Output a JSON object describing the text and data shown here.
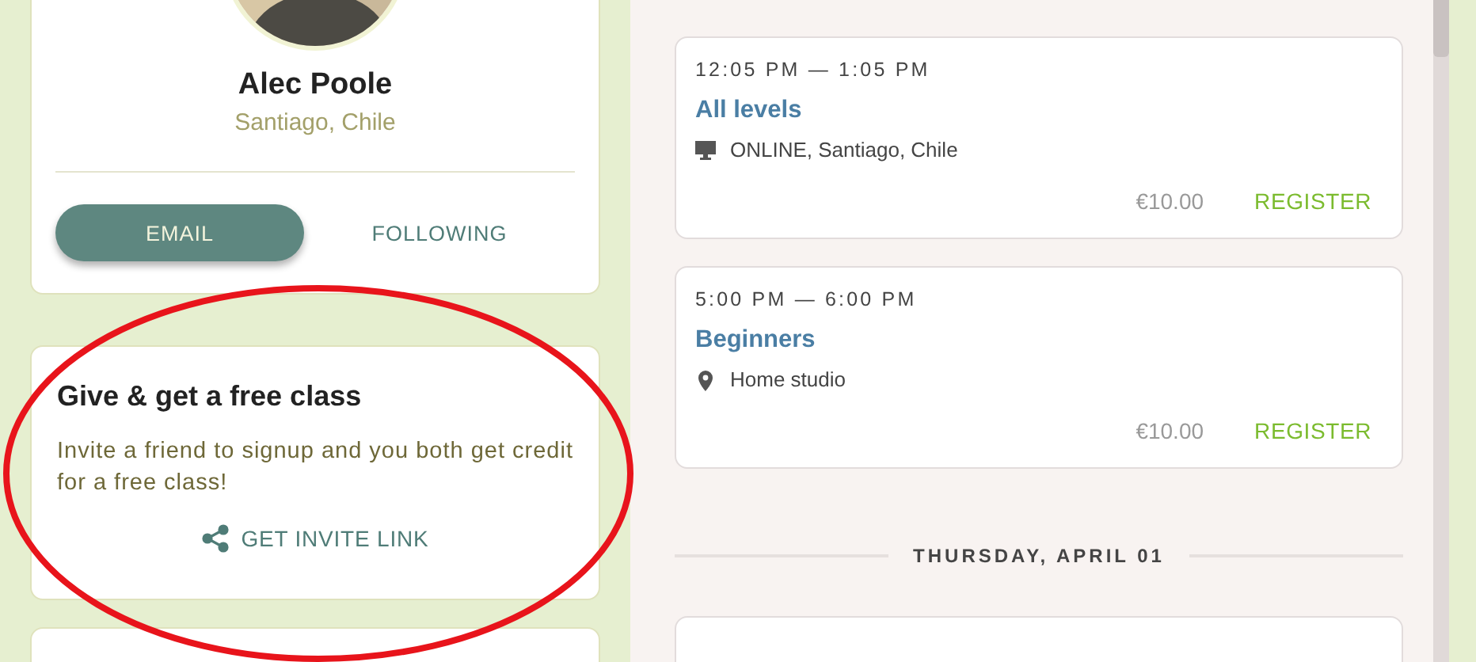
{
  "profile": {
    "name": "Alec Poole",
    "location": "Santiago, Chile",
    "buttons": [
      {
        "label": "EMAIL",
        "kind": "filled"
      },
      {
        "label": "FOLLOWING",
        "kind": "text"
      }
    ]
  },
  "invite": {
    "title": "Give & get a free class",
    "text": "Invite a friend to signup and you both get credit for a free class!",
    "link": "GET INVITE LINK"
  },
  "schedule": [
    {
      "kind": "class",
      "time": "12:05 PM — 1:05 PM",
      "title": "All levels",
      "location": {
        "kind": "online",
        "text": "ONLINE, Santiago, Chile"
      },
      "price": "€10.00",
      "action": "REGISTER"
    },
    {
      "kind": "class",
      "time": "5:00 PM — 6:00 PM",
      "title": "Beginners",
      "location": {
        "kind": "venue",
        "text": "Home studio"
      },
      "price": "€10.00",
      "action": "REGISTER"
    },
    {
      "kind": "day",
      "label": "THURSDAY, APRIL 01"
    },
    {
      "kind": "partial"
    }
  ],
  "annotation": {
    "kind": "ellipse",
    "color": "#e8141b"
  }
}
